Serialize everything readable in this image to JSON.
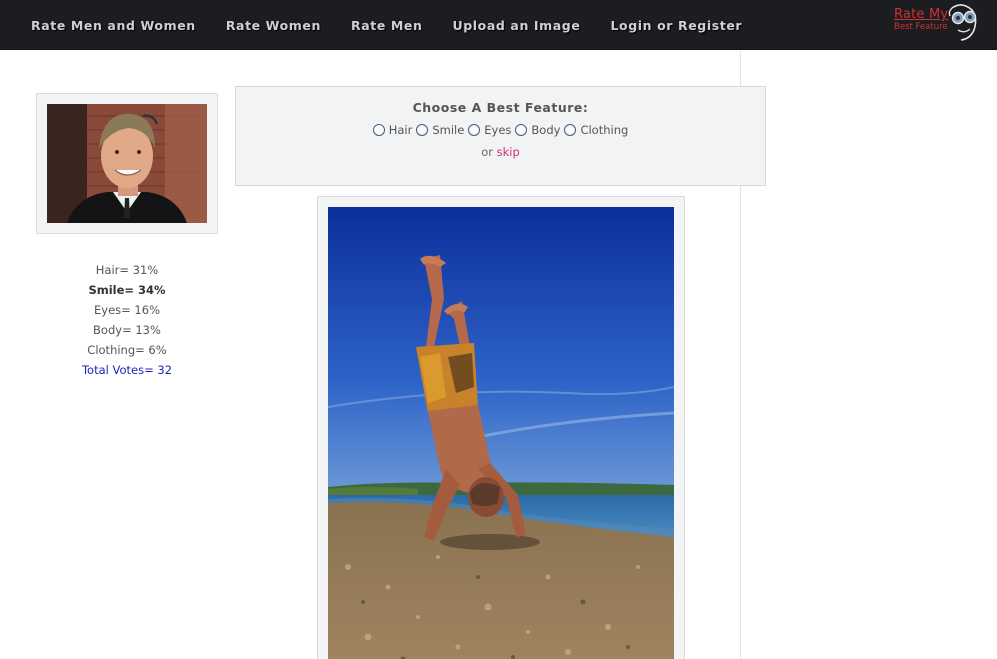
{
  "nav": {
    "items": [
      {
        "label": "Rate Men and Women"
      },
      {
        "label": "Rate Women"
      },
      {
        "label": "Rate Men"
      },
      {
        "label": "Upload an Image"
      },
      {
        "label": "Login or Register"
      }
    ]
  },
  "brand": {
    "line1": "Rate My",
    "line2": "Best Feature",
    "color": "#d03030"
  },
  "stats": {
    "hair": "Hair= 31%",
    "smile": "Smile= 34%",
    "eyes": "Eyes= 16%",
    "body": "Body= 13%",
    "clothing": "Clothing= 6%",
    "total": "Total Votes= 32"
  },
  "feature": {
    "title": "Choose A Best Feature:",
    "options": [
      {
        "label": "Hair"
      },
      {
        "label": "Smile"
      },
      {
        "label": "Eyes"
      },
      {
        "label": "Body"
      },
      {
        "label": "Clothing"
      }
    ],
    "skip_prefix": "or",
    "skip_label": "skip"
  },
  "colors": {
    "navbar": "#1c1d21",
    "accent_link": "#d0307a",
    "total_votes": "#2222bb"
  }
}
